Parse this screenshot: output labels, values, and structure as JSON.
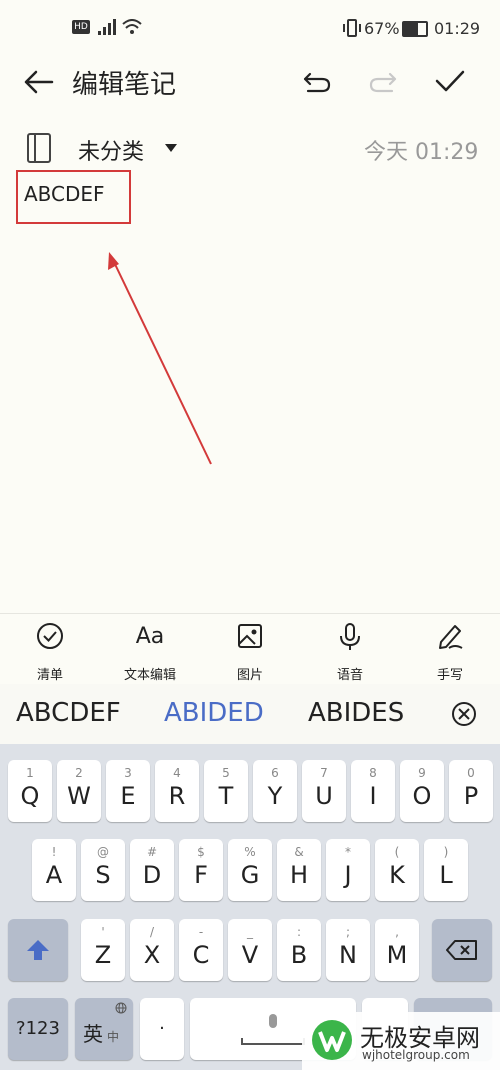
{
  "status_bar": {
    "left_icons": [
      "hd-icon",
      "4g-signal-icon",
      "wifi-icon"
    ],
    "battery_percent": "67%",
    "time": "01:29"
  },
  "header": {
    "title": "编辑笔记"
  },
  "note": {
    "category": "未分类",
    "time": "今天 01:29",
    "content": "ABCDEF"
  },
  "toolbar": {
    "items": [
      {
        "label": "清单",
        "icon": "checklist-icon"
      },
      {
        "label": "文本编辑",
        "icon": "text-format-icon",
        "glyph": "Aa"
      },
      {
        "label": "图片",
        "icon": "image-icon"
      },
      {
        "label": "语音",
        "icon": "microphone-icon"
      },
      {
        "label": "手写",
        "icon": "handwriting-icon"
      }
    ]
  },
  "candidates": {
    "items": [
      "ABCDEF",
      "ABIDED",
      "ABIDES"
    ],
    "highlight_color": "#4a6cc6"
  },
  "keyboard": {
    "row1": [
      {
        "hint": "1",
        "ch": "Q"
      },
      {
        "hint": "2",
        "ch": "W"
      },
      {
        "hint": "3",
        "ch": "E"
      },
      {
        "hint": "4",
        "ch": "R"
      },
      {
        "hint": "5",
        "ch": "T"
      },
      {
        "hint": "6",
        "ch": "Y"
      },
      {
        "hint": "7",
        "ch": "U"
      },
      {
        "hint": "8",
        "ch": "I"
      },
      {
        "hint": "9",
        "ch": "O"
      },
      {
        "hint": "0",
        "ch": "P"
      }
    ],
    "row2": [
      {
        "hint": "!",
        "ch": "A"
      },
      {
        "hint": "@",
        "ch": "S"
      },
      {
        "hint": "#",
        "ch": "D"
      },
      {
        "hint": "$",
        "ch": "F"
      },
      {
        "hint": "%",
        "ch": "G"
      },
      {
        "hint": "&",
        "ch": "H"
      },
      {
        "hint": "*",
        "ch": "J"
      },
      {
        "hint": "(",
        "ch": "K"
      },
      {
        "hint": ")",
        "ch": "L"
      }
    ],
    "row3": [
      {
        "hint": "'",
        "ch": "Z"
      },
      {
        "hint": "/",
        "ch": "X"
      },
      {
        "hint": "-",
        "ch": "C"
      },
      {
        "hint": "_",
        "ch": "V"
      },
      {
        "hint": ":",
        "ch": "B"
      },
      {
        "hint": ";",
        "ch": "N"
      },
      {
        "hint": ",",
        "ch": "M"
      }
    ],
    "row4": {
      "symbols": "?123",
      "lang_main": "英",
      "lang_sub": "中",
      "dot": "·"
    },
    "shift_color": "#4a6cc6"
  },
  "watermark": {
    "brand": "无极安卓网",
    "url": "wjhotelgroup.com"
  },
  "annotation": {
    "color": "#d33a3a"
  }
}
